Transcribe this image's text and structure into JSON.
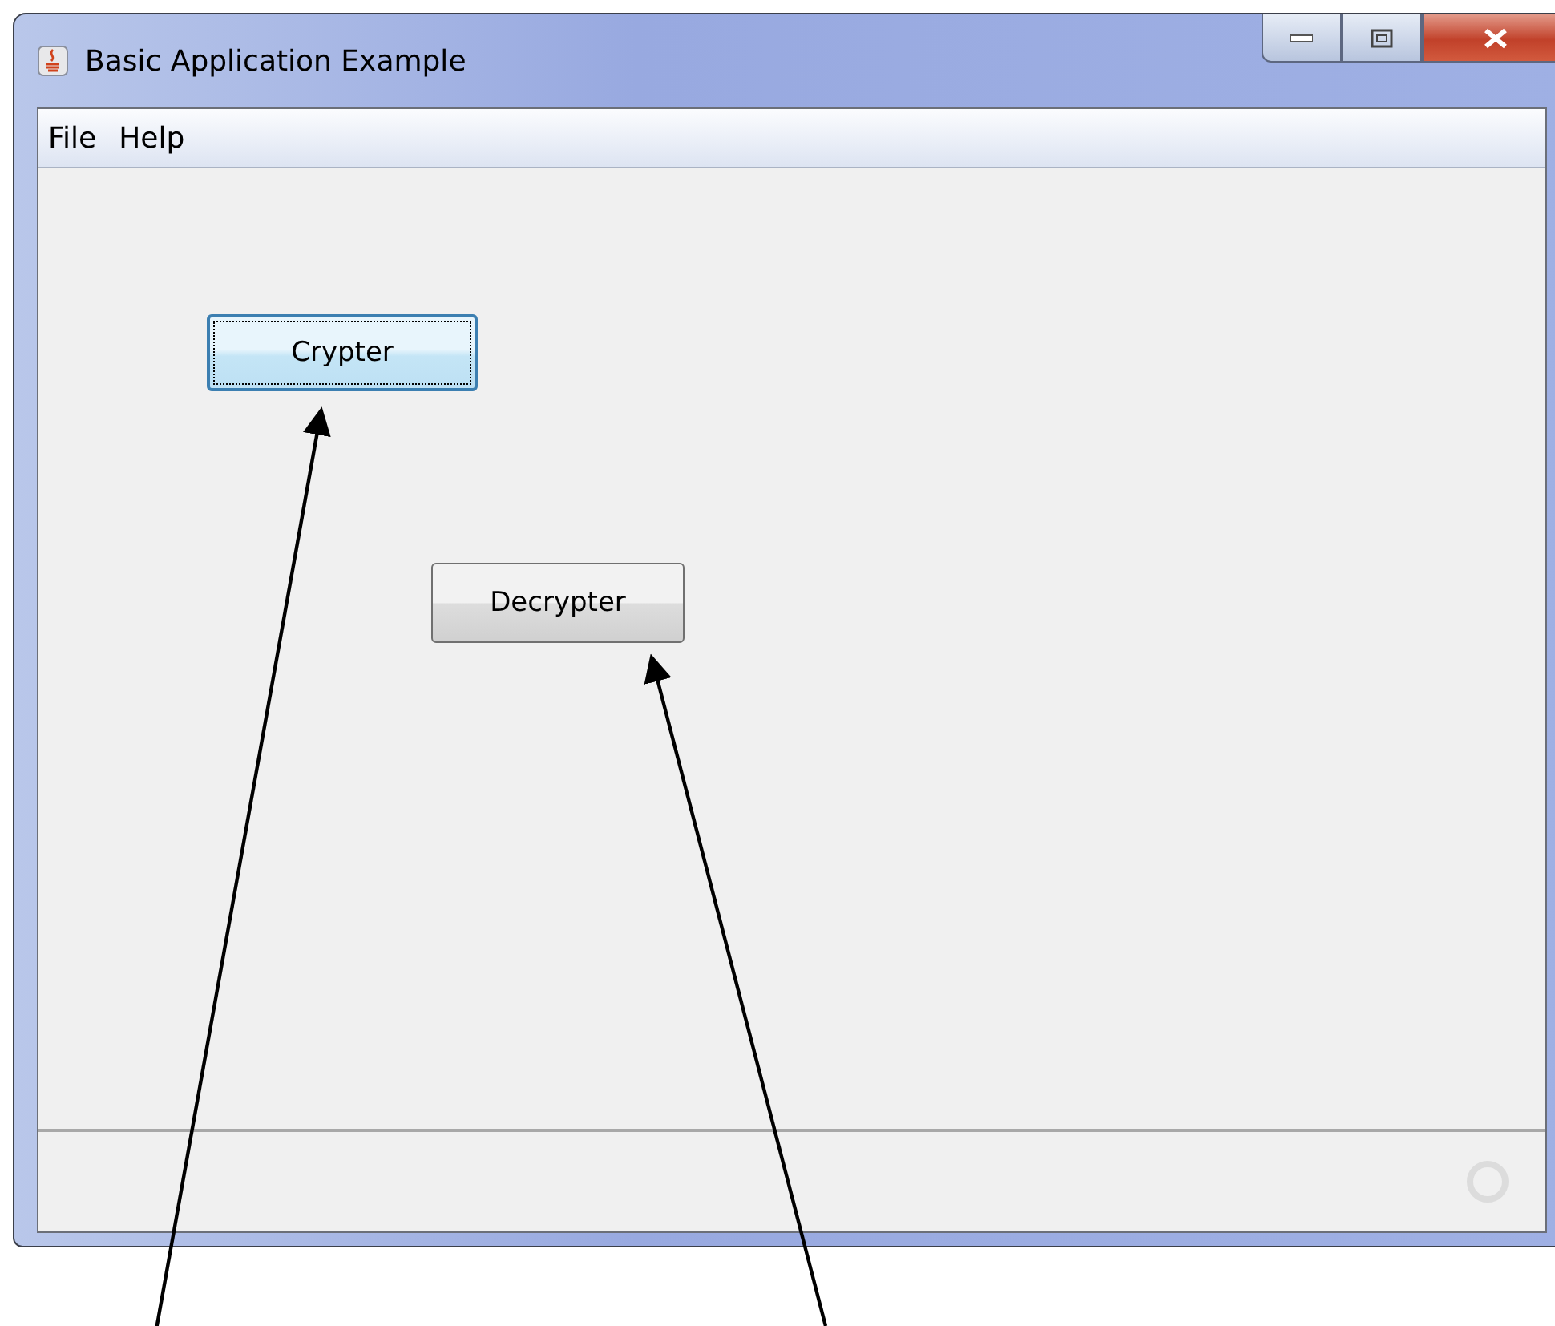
{
  "window": {
    "title": "Basic Application Example"
  },
  "menu": [
    {
      "label": "File"
    },
    {
      "label": "Help"
    }
  ],
  "buttons": [
    {
      "label": "Crypter",
      "focused": true
    },
    {
      "label": "Decrypter",
      "focused": false
    }
  ]
}
